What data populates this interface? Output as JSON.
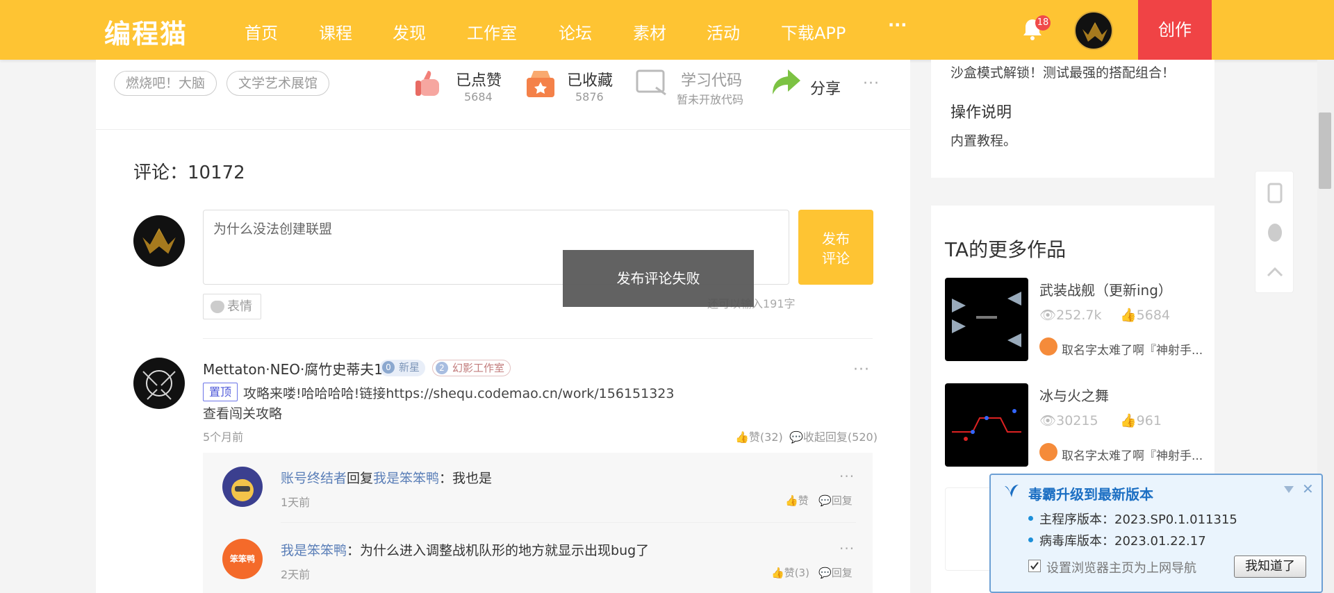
{
  "nav": {
    "logo": "编程猫",
    "items": [
      "首页",
      "课程",
      "发现",
      "工作室",
      "论坛",
      "素材",
      "活动",
      "下载APP"
    ],
    "more": "···",
    "notification_count": "18",
    "create_label": "创作"
  },
  "work": {
    "tags": [
      "燃烧吧！大脑",
      "文学艺术展馆"
    ],
    "like": {
      "label": "已点赞",
      "count": "5684"
    },
    "collect": {
      "label": "已收藏",
      "count": "5876"
    },
    "code": {
      "label": "学习代码",
      "sub": "暂未开放代码"
    },
    "share": {
      "label": "分享"
    },
    "more": "···"
  },
  "comments": {
    "title": "评论：10172",
    "input_value": "为什么没法创建联盟",
    "publish_label": "发布\n评论",
    "emoji_label": "表情",
    "char_limit": "还可以输入191字",
    "toast": "发布评论失败",
    "items": [
      {
        "user": "Mettaton·NEO·腐竹史蒂夫1",
        "badge_new": "新星",
        "badge_new_level": "0",
        "badge_studio": "幻影工作室",
        "badge_studio_level": "2",
        "pin": "置顶",
        "text": "攻略来喽!哈哈哈哈!链接https://shequ.codemao.cn/work/156151323",
        "text2": "查看闯关攻略",
        "time": "5个月前",
        "likes": "赞(32)",
        "collapse": "收起回复(520)",
        "more": "···",
        "replies": [
          {
            "user": "账号终结者",
            "reply_word": "回复",
            "target": "我是笨笨鸭",
            "text": "：我也是",
            "time": "1天前",
            "like": "赞",
            "reply": "回复",
            "more": "···"
          },
          {
            "user": "我是笨笨鸭",
            "text": "：为什么进入调整战机队形的地方就显示出现bug了",
            "time": "2天前",
            "like": "赞(3)",
            "reply": "回复",
            "more": "···",
            "avatar_text": "笨笨鸭"
          }
        ]
      }
    ]
  },
  "sidebar": {
    "intro_tail": "沙盒模式解锁！测试最强的搭配组合！",
    "instructions_title": "操作说明",
    "instructions_text": "内置教程。",
    "more_works_title": "TA的更多作品",
    "works": [
      {
        "title": "武装战舰（更新ing）",
        "views": "252.7k",
        "likes": "5684",
        "author": "取名字太难了啊『神射手..."
      },
      {
        "title": "冰与火之舞",
        "views": "30215",
        "likes": "961",
        "author": "取名字太难了啊『神射手..."
      }
    ]
  },
  "popup": {
    "title": "毒霸升级到最新版本",
    "main_version": "主程序版本：2023.SP0.1.011315",
    "virus_version": "病毒库版本：2023.01.22.17",
    "checkbox_label": "设置浏览器主页为上网导航",
    "ok_label": "我知道了"
  },
  "colors": {
    "brand": "#fec433",
    "create": "#f04345",
    "link": "#5b7fb8"
  }
}
